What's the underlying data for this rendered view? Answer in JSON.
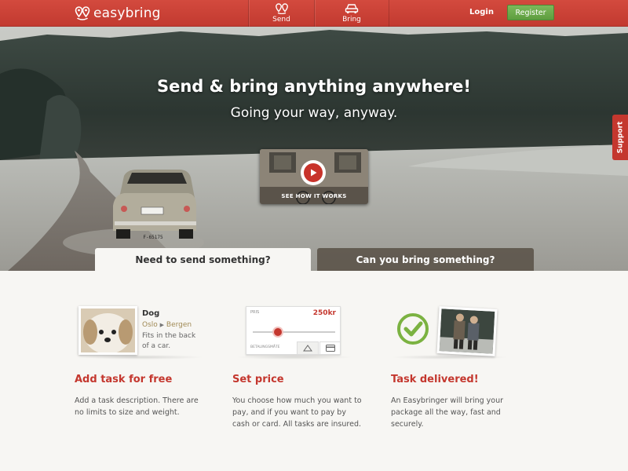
{
  "header": {
    "logo_text": "easybring",
    "nav": [
      {
        "label": "Send",
        "icon": "map-pins-icon"
      },
      {
        "label": "Bring",
        "icon": "car-icon"
      }
    ],
    "login_label": "Login",
    "register_label": "Register",
    "brand_color": "#c23a30",
    "register_color": "#6aab4a"
  },
  "hero": {
    "title": "Send & bring anything anywhere!",
    "subtitle": "Going your way, anyway.",
    "video_caption": "SEE HOW IT WORKS",
    "license_plate": "F-65175",
    "support_label": "Support",
    "tabs": [
      {
        "label": "Need to send something?",
        "active": true
      },
      {
        "label": "Can you bring something?",
        "active": false
      }
    ]
  },
  "steps": [
    {
      "title": "Add task for free",
      "text": "Add a task description. There are no limits to size and weight.",
      "card": {
        "name": "Dog",
        "from": "Oslo",
        "to": "Bergen",
        "arrow": "▶",
        "note": "Fits in the back of a car."
      }
    },
    {
      "title": "Set price",
      "text": "You choose how much you want to pay, and if you want to pay by cash or card. All tasks are insured.",
      "card": {
        "price_label": "PRIS",
        "price_value": "250kr",
        "payment_label": "BETALINGSMÅTE",
        "slider_level": 0.3
      }
    },
    {
      "title": "Task delivered!",
      "text": "An Easybringer will bring your package all the way, fast and securely.",
      "card": {
        "icon": "check-circle-icon"
      }
    }
  ]
}
